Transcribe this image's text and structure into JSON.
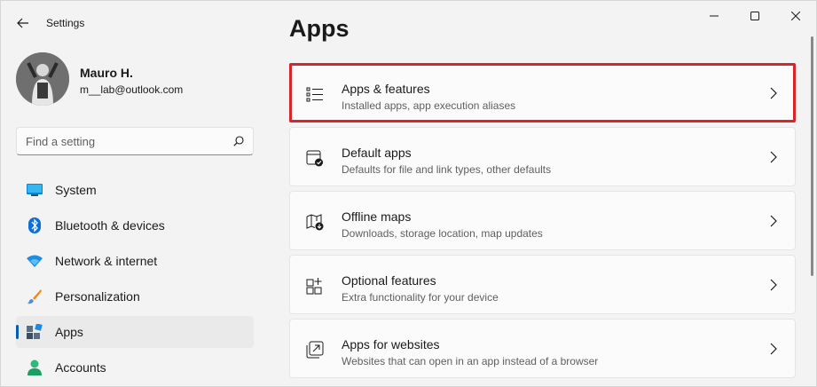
{
  "window": {
    "title": "Settings"
  },
  "profile": {
    "name": "Mauro H.",
    "email": "m__lab@outlook.com"
  },
  "search": {
    "placeholder": "Find a setting"
  },
  "nav": {
    "items": [
      {
        "label": "System",
        "icon": "system-icon"
      },
      {
        "label": "Bluetooth & devices",
        "icon": "bluetooth-icon"
      },
      {
        "label": "Network & internet",
        "icon": "wifi-icon"
      },
      {
        "label": "Personalization",
        "icon": "brush-icon"
      },
      {
        "label": "Apps",
        "icon": "apps-icon",
        "selected": true
      },
      {
        "label": "Accounts",
        "icon": "person-icon"
      }
    ]
  },
  "main": {
    "title": "Apps",
    "cards": [
      {
        "title": "Apps & features",
        "subtitle": "Installed apps, app execution aliases",
        "icon": "list-icon",
        "highlighted": true
      },
      {
        "title": "Default apps",
        "subtitle": "Defaults for file and link types, other defaults",
        "icon": "default-apps-icon"
      },
      {
        "title": "Offline maps",
        "subtitle": "Downloads, storage location, map updates",
        "icon": "map-icon"
      },
      {
        "title": "Optional features",
        "subtitle": "Extra functionality for your device",
        "icon": "optional-features-icon"
      },
      {
        "title": "Apps for websites",
        "subtitle": "Websites that can open in an app instead of a browser",
        "icon": "open-link-icon"
      }
    ]
  },
  "colors": {
    "accent": "#005fb8",
    "highlight_border": "#d6262b",
    "background": "#f3f3f3",
    "card": "#fbfbfb"
  }
}
